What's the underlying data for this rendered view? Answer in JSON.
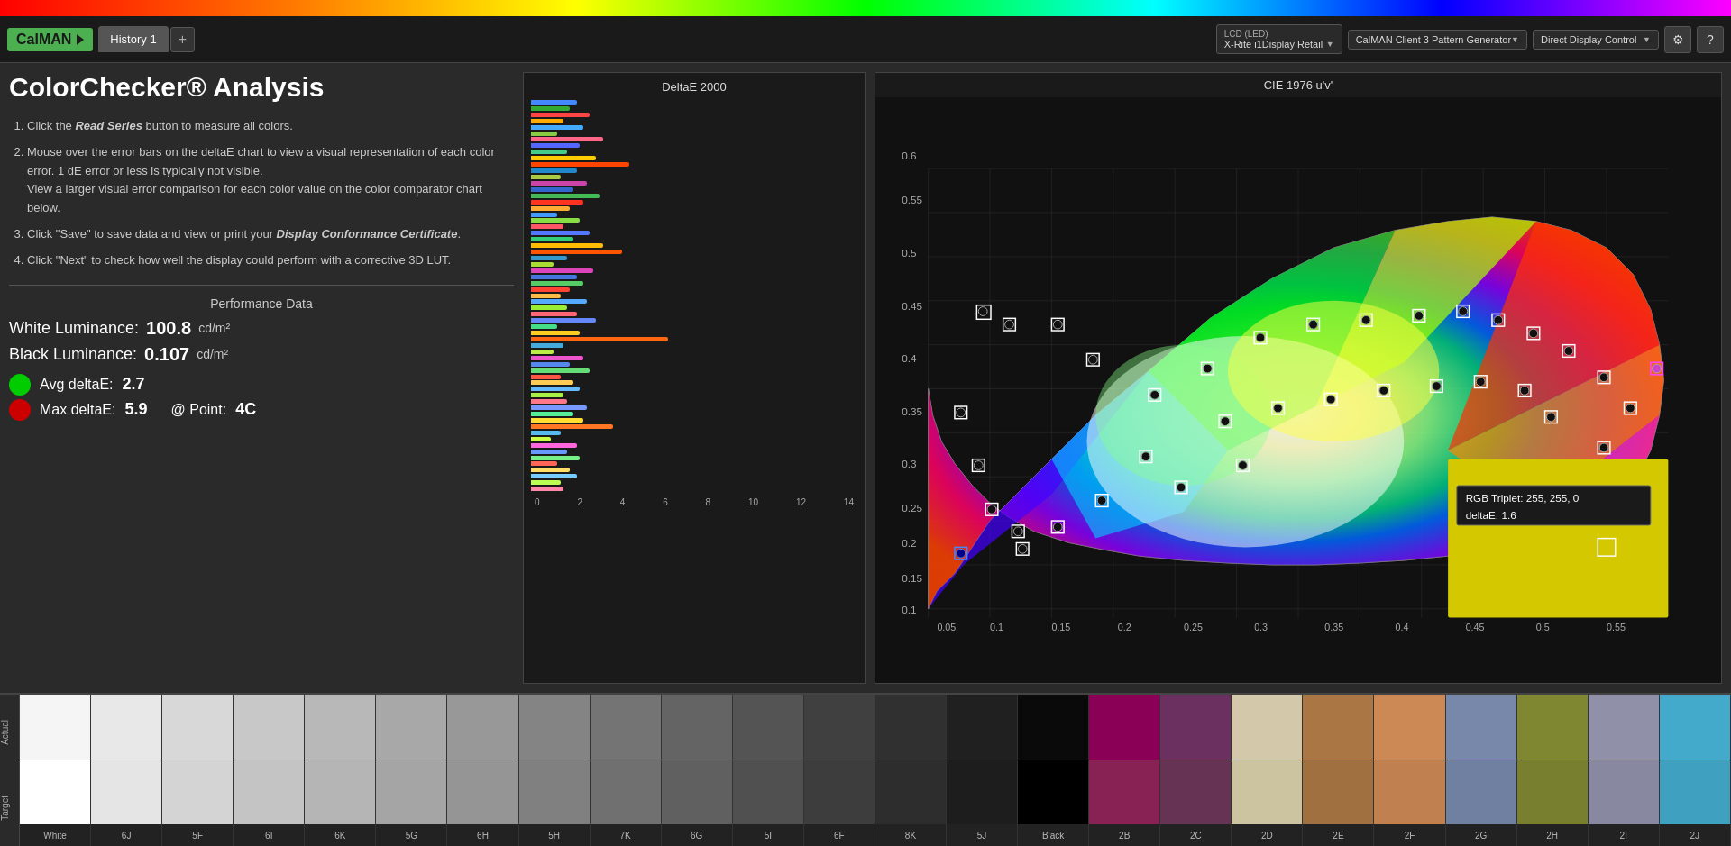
{
  "app": {
    "name": "CalMAN",
    "rainbow_bar": true
  },
  "tabs": [
    {
      "id": "history1",
      "label": "History 1",
      "active": true
    }
  ],
  "devices": {
    "meter": {
      "label": "X-Rite i1Display Retail",
      "sublabel": "LCD (LED)"
    },
    "generator": {
      "label": "CalMAN Client 3 Pattern Generator"
    },
    "display": {
      "label": "Direct Display Control"
    }
  },
  "page": {
    "title": "ColorChecker® Analysis"
  },
  "instructions": [
    {
      "id": 1,
      "text_parts": [
        {
          "text": "Click the "
        },
        {
          "text": "Read Series",
          "italic": true
        },
        {
          "text": " button to measure all colors."
        }
      ]
    },
    {
      "id": 2,
      "text_parts": [
        {
          "text": "Mouse over the error bars on the deltaE chart to view a visual representation of each color error. 1 dE error or less is typically not visible."
        },
        {
          "text": " View a larger visual error comparison for each color value on the color comparator chart below."
        }
      ]
    },
    {
      "id": 3,
      "text_parts": [
        {
          "text": "Click \"Save\" to save data and view or print your "
        },
        {
          "text": "Display Conformance Certificate",
          "italic": true
        },
        {
          "text": "."
        }
      ]
    },
    {
      "id": 4,
      "text_parts": [
        {
          "text": "Click \"Next\" to check how well the display could perform with a corrective 3D LUT."
        }
      ]
    }
  ],
  "performance": {
    "title": "Performance Data",
    "white_luminance_label": "White Luminance:",
    "white_luminance_value": "100.8",
    "white_luminance_unit": "cd/m²",
    "black_luminance_label": "Black Luminance:",
    "black_luminance_value": "0.107",
    "black_luminance_unit": "cd/m²",
    "avg_delta_label": "Avg deltaE:",
    "avg_delta_value": "2.7",
    "max_delta_label": "Max deltaE:",
    "max_delta_value": "5.9",
    "max_delta_point_label": "@ Point:",
    "max_delta_point_value": "4C"
  },
  "deltae_chart": {
    "title": "DeltaE 2000",
    "x_axis_labels": [
      "0",
      "2",
      "4",
      "6",
      "8",
      "10",
      "12",
      "14"
    ],
    "bars": [
      {
        "color": "#4488ff",
        "width_pct": 14,
        "label": ""
      },
      {
        "color": "#33aa33",
        "width_pct": 12,
        "label": ""
      },
      {
        "color": "#ff4444",
        "width_pct": 18,
        "label": ""
      },
      {
        "color": "#ffaa00",
        "width_pct": 10,
        "label": ""
      },
      {
        "color": "#44aaff",
        "width_pct": 16,
        "label": ""
      },
      {
        "color": "#88cc44",
        "width_pct": 8,
        "label": ""
      },
      {
        "color": "#ff6688",
        "width_pct": 22,
        "label": ""
      },
      {
        "color": "#5566ff",
        "width_pct": 15,
        "label": ""
      },
      {
        "color": "#44cc88",
        "width_pct": 11,
        "label": ""
      },
      {
        "color": "#ffcc00",
        "width_pct": 20,
        "label": ""
      },
      {
        "color": "#ff4400",
        "width_pct": 30,
        "label": ""
      },
      {
        "color": "#2288cc",
        "width_pct": 14,
        "label": ""
      },
      {
        "color": "#aacc44",
        "width_pct": 9,
        "label": ""
      },
      {
        "color": "#cc44aa",
        "width_pct": 17,
        "label": ""
      },
      {
        "color": "#3366cc",
        "width_pct": 13,
        "label": ""
      },
      {
        "color": "#44bb55",
        "width_pct": 21,
        "label": ""
      },
      {
        "color": "#ff3322",
        "width_pct": 16,
        "label": ""
      },
      {
        "color": "#ffaa33",
        "width_pct": 12,
        "label": ""
      },
      {
        "color": "#4499ff",
        "width_pct": 8,
        "label": ""
      },
      {
        "color": "#88dd44",
        "width_pct": 15,
        "label": ""
      },
      {
        "color": "#ff5566",
        "width_pct": 10,
        "label": ""
      },
      {
        "color": "#5577ff",
        "width_pct": 18,
        "label": ""
      },
      {
        "color": "#33cc77",
        "width_pct": 13,
        "label": ""
      },
      {
        "color": "#ffbb00",
        "width_pct": 22,
        "label": ""
      },
      {
        "color": "#ff5500",
        "width_pct": 28,
        "label": ""
      },
      {
        "color": "#3399cc",
        "width_pct": 11,
        "label": ""
      },
      {
        "color": "#aadd33",
        "width_pct": 7,
        "label": ""
      },
      {
        "color": "#dd44bb",
        "width_pct": 19,
        "label": ""
      },
      {
        "color": "#4477dd",
        "width_pct": 14,
        "label": ""
      },
      {
        "color": "#55cc66",
        "width_pct": 16,
        "label": ""
      },
      {
        "color": "#ff4433",
        "width_pct": 12,
        "label": ""
      },
      {
        "color": "#ffbb44",
        "width_pct": 9,
        "label": ""
      },
      {
        "color": "#55aaff",
        "width_pct": 17,
        "label": ""
      },
      {
        "color": "#99ee33",
        "width_pct": 11,
        "label": ""
      },
      {
        "color": "#ff6677",
        "width_pct": 14,
        "label": ""
      },
      {
        "color": "#6688ff",
        "width_pct": 20,
        "label": ""
      },
      {
        "color": "#44dd88",
        "width_pct": 8,
        "label": ""
      },
      {
        "color": "#ffcc22",
        "width_pct": 15,
        "label": ""
      },
      {
        "color": "#ff6611",
        "width_pct": 42,
        "label": ""
      },
      {
        "color": "#44aadd",
        "width_pct": 10,
        "label": ""
      },
      {
        "color": "#bbee44",
        "width_pct": 7,
        "label": ""
      },
      {
        "color": "#ee55cc",
        "width_pct": 16,
        "label": ""
      },
      {
        "color": "#5588ee",
        "width_pct": 12,
        "label": ""
      },
      {
        "color": "#66dd77",
        "width_pct": 18,
        "label": ""
      },
      {
        "color": "#ff5544",
        "width_pct": 9,
        "label": ""
      },
      {
        "color": "#ffcc55",
        "width_pct": 13,
        "label": ""
      },
      {
        "color": "#66bbff",
        "width_pct": 15,
        "label": ""
      },
      {
        "color": "#aaf044",
        "width_pct": 10,
        "label": ""
      },
      {
        "color": "#ff7788",
        "width_pct": 11,
        "label": ""
      },
      {
        "color": "#7799ff",
        "width_pct": 17,
        "label": ""
      },
      {
        "color": "#55ee99",
        "width_pct": 13,
        "label": ""
      },
      {
        "color": "#ffdd33",
        "width_pct": 16,
        "label": ""
      },
      {
        "color": "#ff7722",
        "width_pct": 25,
        "label": ""
      },
      {
        "color": "#55bbee",
        "width_pct": 9,
        "label": ""
      },
      {
        "color": "#ccff44",
        "width_pct": 6,
        "label": ""
      },
      {
        "color": "#ff66dd",
        "width_pct": 14,
        "label": ""
      },
      {
        "color": "#6699ff",
        "width_pct": 11,
        "label": ""
      },
      {
        "color": "#77ee88",
        "width_pct": 15,
        "label": ""
      },
      {
        "color": "#ff6655",
        "width_pct": 8,
        "label": ""
      },
      {
        "color": "#ffdd66",
        "width_pct": 12,
        "label": ""
      },
      {
        "color": "#77ccff",
        "width_pct": 14,
        "label": ""
      },
      {
        "color": "#bbff55",
        "width_pct": 9,
        "label": ""
      },
      {
        "color": "#ff88aa",
        "width_pct": 10,
        "label": ""
      }
    ]
  },
  "cie_chart": {
    "title": "CIE 1976 u'v'",
    "tooltip": {
      "line1": "RGB Triplet: 255, 255, 0",
      "line2": "deltaE: 1.6"
    }
  },
  "swatches": {
    "actual_label": "Actual",
    "target_label": "Target",
    "items": [
      {
        "name": "White",
        "actual_color": "#f5f5f5",
        "target_color": "#ffffff"
      },
      {
        "name": "6J",
        "actual_color": "#e8e8e8",
        "target_color": "#e5e5e5"
      },
      {
        "name": "5F",
        "actual_color": "#d8d8d8",
        "target_color": "#d4d4d4"
      },
      {
        "name": "6I",
        "actual_color": "#c8c8c8",
        "target_color": "#c4c4c4"
      },
      {
        "name": "6K",
        "actual_color": "#b8b8b8",
        "target_color": "#b5b5b5"
      },
      {
        "name": "5G",
        "actual_color": "#a8a8a8",
        "target_color": "#a5a5a5"
      },
      {
        "name": "6H",
        "actual_color": "#989898",
        "target_color": "#959595"
      },
      {
        "name": "5H",
        "actual_color": "#848484",
        "target_color": "#808080"
      },
      {
        "name": "7K",
        "actual_color": "#747474",
        "target_color": "#707070"
      },
      {
        "name": "6G",
        "actual_color": "#646464",
        "target_color": "#606060"
      },
      {
        "name": "5I",
        "actual_color": "#545454",
        "target_color": "#505050"
      },
      {
        "name": "6F",
        "actual_color": "#404040",
        "target_color": "#3d3d3d"
      },
      {
        "name": "8K",
        "actual_color": "#303030",
        "target_color": "#2d2d2d"
      },
      {
        "name": "5J",
        "actual_color": "#202020",
        "target_color": "#1d1d1d"
      },
      {
        "name": "Black",
        "actual_color": "#0a0a0a",
        "target_color": "#000000"
      },
      {
        "name": "2B",
        "actual_color": "#8b0057",
        "target_color": "#882255"
      },
      {
        "name": "2C",
        "actual_color": "#6b3060",
        "target_color": "#663355"
      },
      {
        "name": "2D",
        "actual_color": "#d4c8aa",
        "target_color": "#ccc4a0"
      },
      {
        "name": "2E",
        "actual_color": "#aa7744",
        "target_color": "#a07040"
      },
      {
        "name": "2F",
        "actual_color": "#cc8855",
        "target_color": "#c08050"
      },
      {
        "name": "2G",
        "actual_color": "#7788aa",
        "target_color": "#7080a0"
      },
      {
        "name": "2H",
        "actual_color": "#7f8830",
        "target_color": "#788030"
      },
      {
        "name": "2I",
        "actual_color": "#9090a8",
        "target_color": "#8888a0"
      },
      {
        "name": "2J",
        "actual_color": "#44aacc",
        "target_color": "#40a0c0"
      }
    ]
  }
}
